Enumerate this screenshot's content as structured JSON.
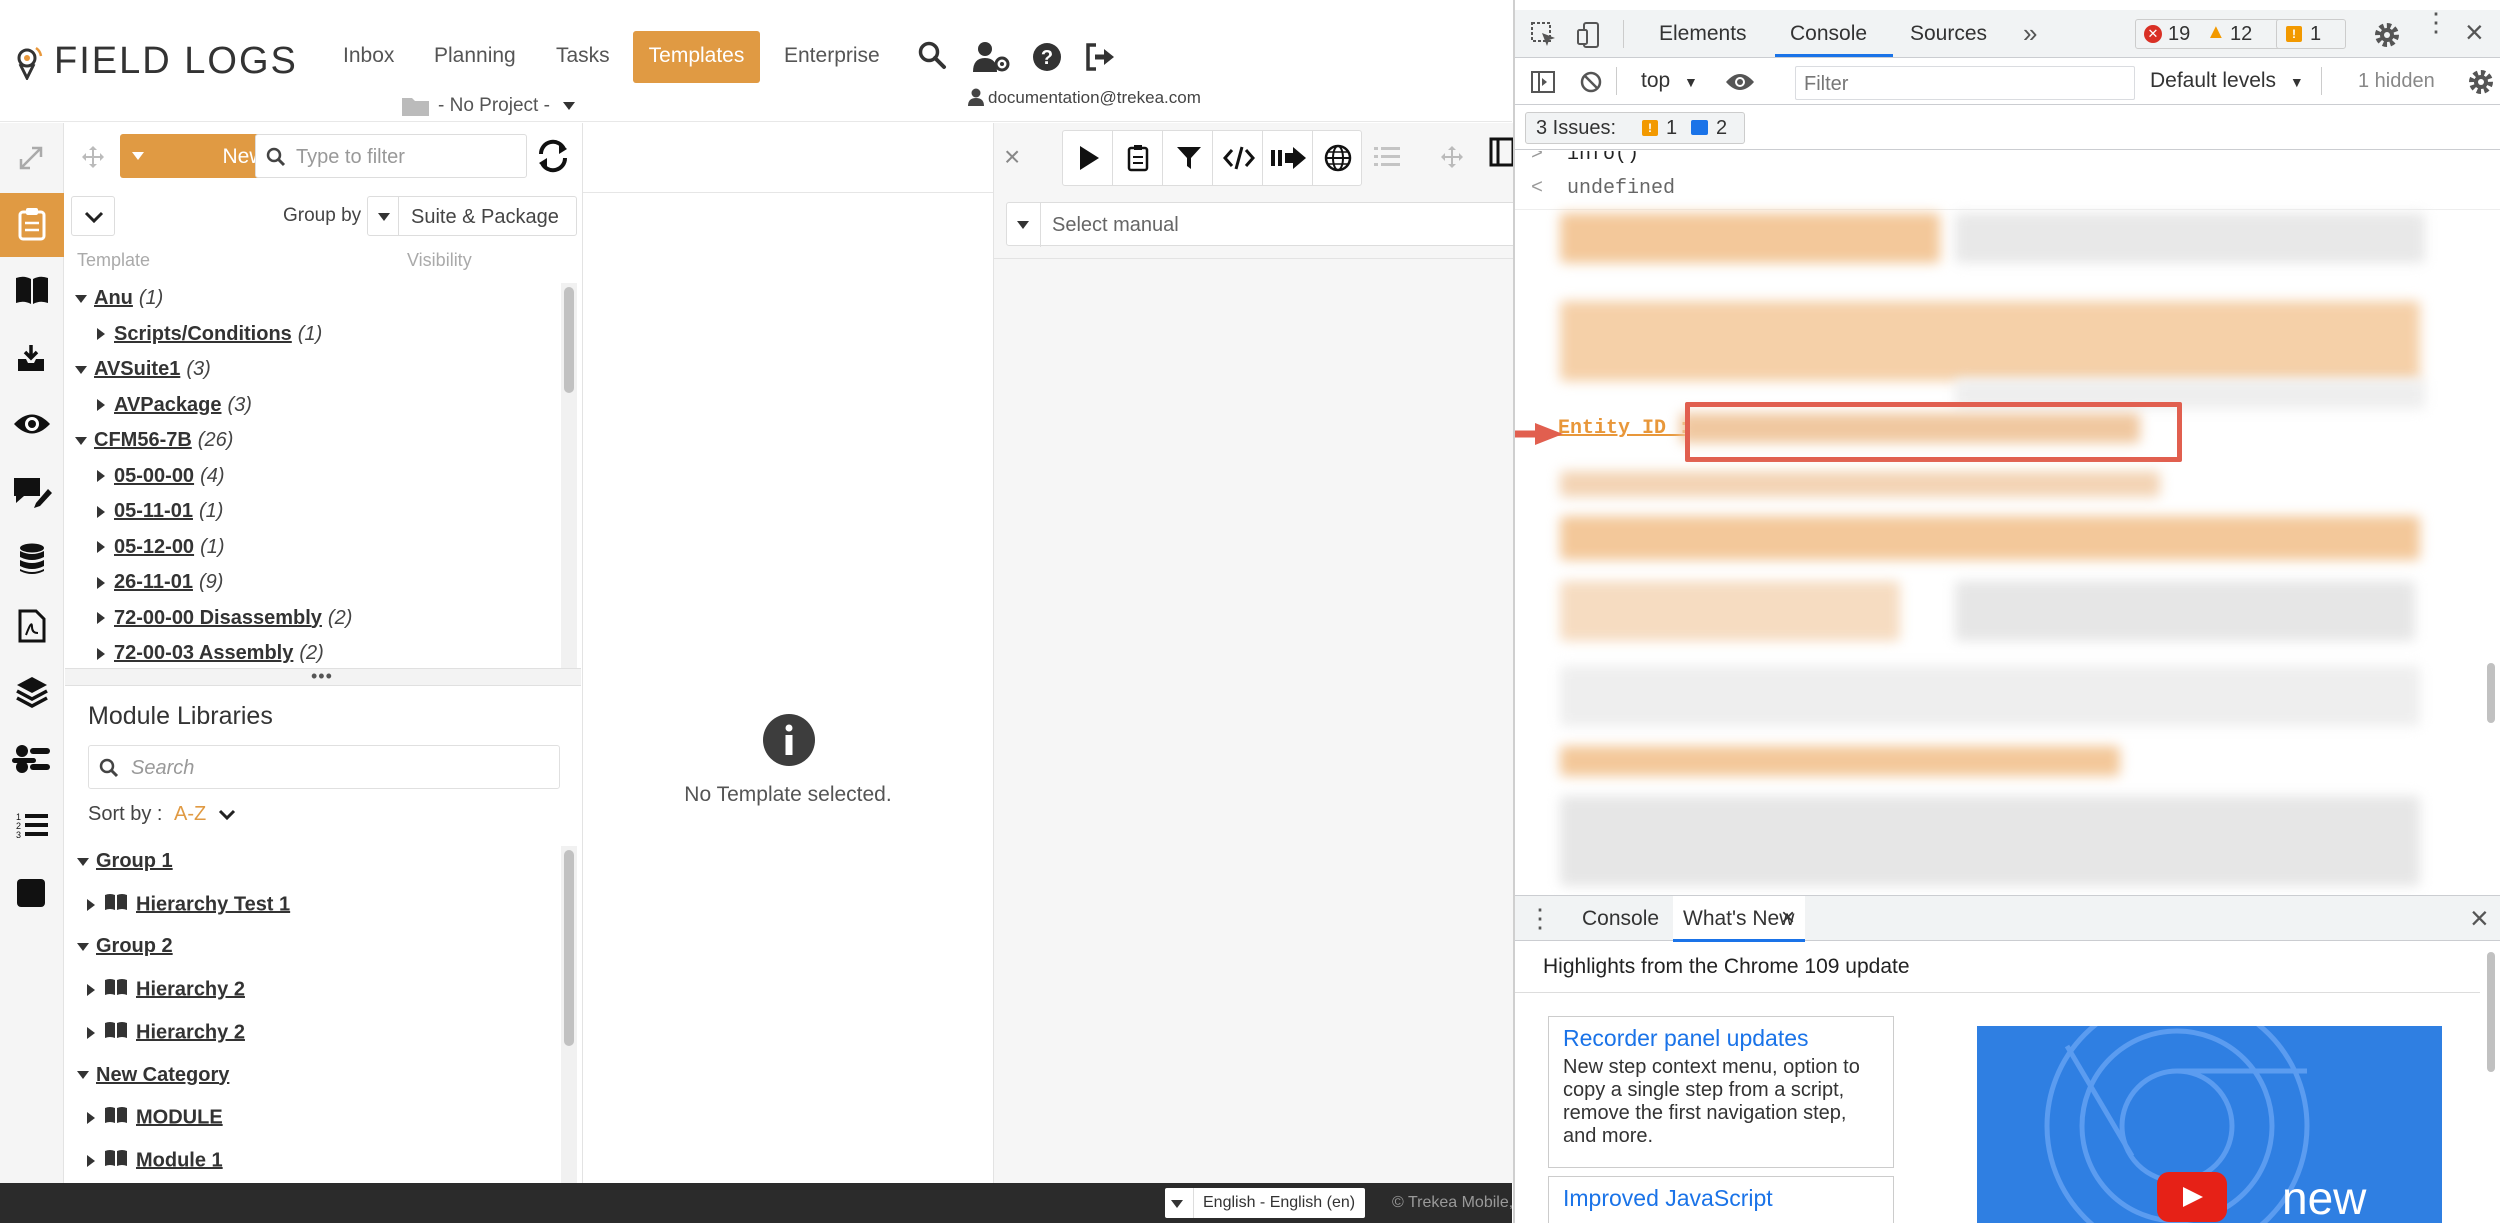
{
  "app": {
    "logo_text": "FIELD LOGS",
    "nav": [
      "Inbox",
      "Planning",
      "Tasks",
      "Templates",
      "Enterprise"
    ],
    "project": "- No Project -",
    "user_email": "documentation@trekea.com"
  },
  "toolbar": {
    "new_label": "New",
    "filter_placeholder": "Type to filter",
    "group_by_label": "Group by",
    "group_by_value": "Suite & Package",
    "col_template": "Template",
    "col_visibility": "Visibility"
  },
  "tree": [
    {
      "name": "Anu",
      "count": "(1)",
      "level": 0,
      "open": true
    },
    {
      "name": "Scripts/Conditions",
      "count": "(1)",
      "level": 1,
      "open": false
    },
    {
      "name": "AVSuite1",
      "count": "(3)",
      "level": 0,
      "open": true
    },
    {
      "name": "AVPackage",
      "count": "(3)",
      "level": 1,
      "open": false
    },
    {
      "name": "CFM56-7B",
      "count": "(26)",
      "level": 0,
      "open": true
    },
    {
      "name": "05-00-00",
      "count": "(4)",
      "level": 1,
      "open": false
    },
    {
      "name": "05-11-01",
      "count": "(1)",
      "level": 1,
      "open": false
    },
    {
      "name": "05-12-00",
      "count": "(1)",
      "level": 1,
      "open": false
    },
    {
      "name": "26-11-01",
      "count": "(9)",
      "level": 1,
      "open": false
    },
    {
      "name": "72-00-00 Disassembly",
      "count": "(2)",
      "level": 1,
      "open": false
    },
    {
      "name": "72-00-03 Assembly",
      "count": "(2)",
      "level": 1,
      "open": false
    }
  ],
  "modules": {
    "title": "Module Libraries",
    "search_placeholder": "Search",
    "sort_label": "Sort by :",
    "sort_value": "A-Z",
    "items": [
      {
        "name": "Group 1",
        "level": 0,
        "book": false
      },
      {
        "name": "Hierarchy Test 1",
        "level": 1,
        "book": true
      },
      {
        "name": "Group 2",
        "level": 0,
        "book": false
      },
      {
        "name": "Hierarchy 2",
        "level": 1,
        "book": true
      },
      {
        "name": "Hierarchy 2",
        "level": 1,
        "book": true
      },
      {
        "name": "New Category",
        "level": 0,
        "book": false
      },
      {
        "name": "MODULE",
        "level": 1,
        "book": true
      },
      {
        "name": "Module 1",
        "level": 1,
        "book": true
      }
    ]
  },
  "center": {
    "empty_text": "No Template selected."
  },
  "right": {
    "manual_placeholder": "Select manual"
  },
  "footer": {
    "language": "English - English (en)",
    "copyright": "© Trekea Mobile,"
  },
  "devtools": {
    "tabs": [
      "Elements",
      "Console",
      "Sources"
    ],
    "errors": "19",
    "warnings": "12",
    "info": "1",
    "context": "top",
    "filter_placeholder": "Filter",
    "levels": "Default levels",
    "hidden": "1 hidden",
    "issues_label": "3 Issues:",
    "issues_warn": "1",
    "issues_info": "2",
    "console_lines": [
      {
        "prompt": ">",
        "text": "info()"
      },
      {
        "prompt": "<",
        "text": "undefined"
      }
    ],
    "entity_label": "Entity ID :",
    "drawer_tabs": [
      "Console",
      "What's New"
    ],
    "whatsnew_heading": "Highlights from the Chrome 109 update",
    "cards": [
      {
        "title": "Recorder panel updates",
        "body": "New step context menu, option to copy a single step from a script, remove the first navigation step, and more."
      },
      {
        "title": "Improved JavaScript",
        "body": ""
      }
    ],
    "video_text": "new"
  }
}
